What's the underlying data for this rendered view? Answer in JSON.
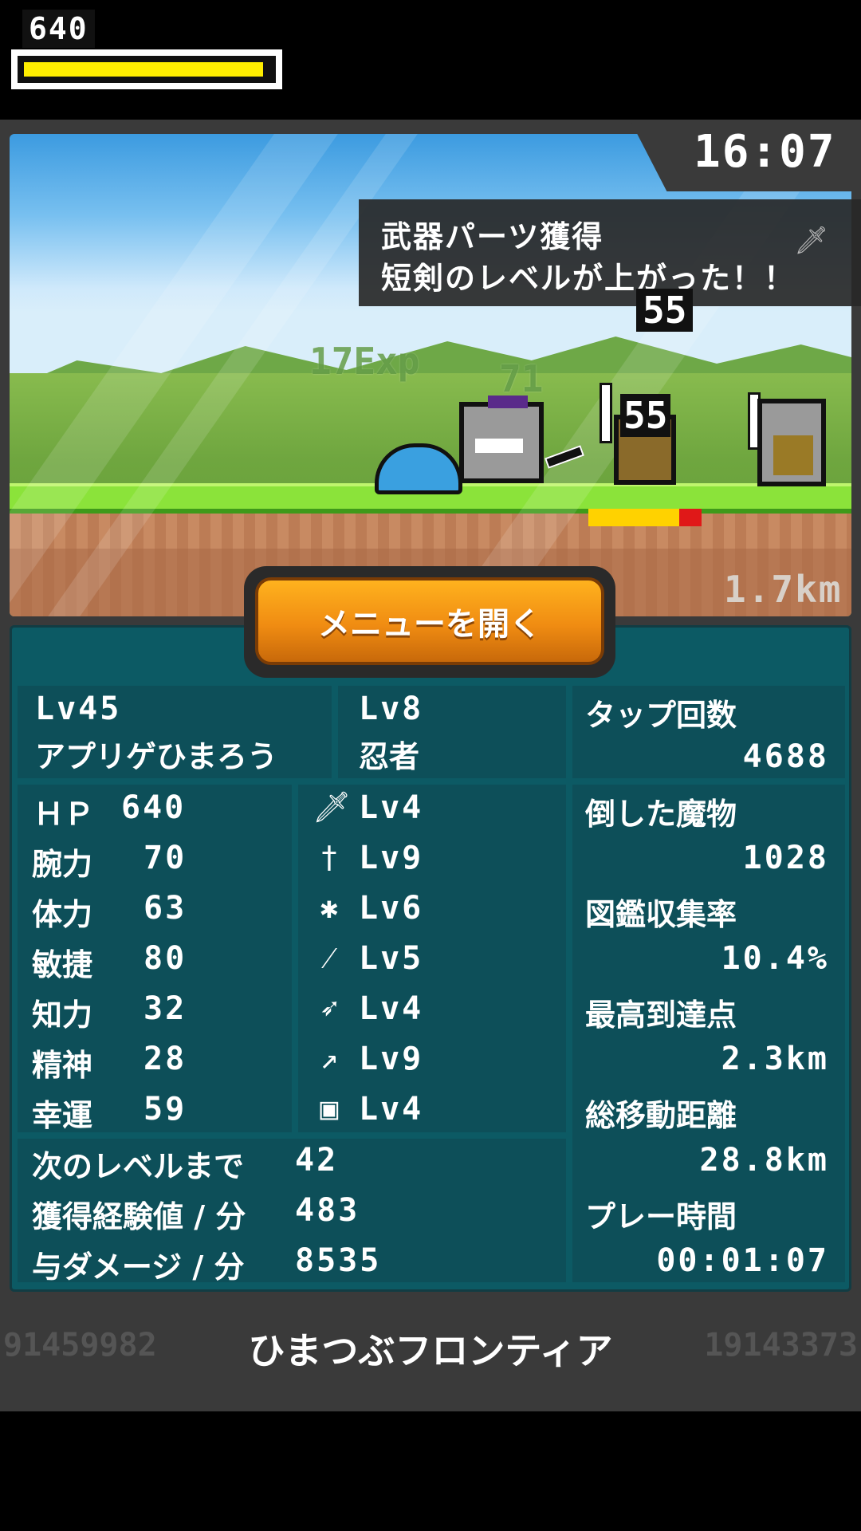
{
  "hud": {
    "hp_value": "640",
    "hp_fill": 0.95,
    "clock": "16:07",
    "distance": "1.7km"
  },
  "toast": {
    "line1": "武器パーツ獲得",
    "line2": "短剣のレベルが上がった！！",
    "icon": "dagger-icon"
  },
  "popups": {
    "damage_top": "55",
    "exp": "17Exp",
    "faded_num": "71",
    "enemy_damage": "55"
  },
  "enemy_hp_fill": 0.8,
  "menu_button": "メニューを開く",
  "player": {
    "level": "Lv45",
    "name": "アプリゲひまろう",
    "class_level": "Lv8",
    "class_name": "忍者"
  },
  "stats": [
    {
      "label": "ＨＰ",
      "value": "640"
    },
    {
      "label": "腕力",
      "value": "70"
    },
    {
      "label": "体力",
      "value": "63"
    },
    {
      "label": "敏捷",
      "value": "80"
    },
    {
      "label": "知力",
      "value": "32"
    },
    {
      "label": "精神",
      "value": "28"
    },
    {
      "label": "幸運",
      "value": "59"
    }
  ],
  "weapons": [
    {
      "icon": "sword-icon",
      "level": "Lv4"
    },
    {
      "icon": "dagger-icon",
      "level": "Lv9"
    },
    {
      "icon": "axe-icon",
      "level": "Lv6"
    },
    {
      "icon": "spear-icon",
      "level": "Lv5"
    },
    {
      "icon": "bow-icon",
      "level": "Lv4"
    },
    {
      "icon": "staff-icon",
      "level": "Lv9"
    },
    {
      "icon": "shield-icon",
      "level": "Lv4"
    }
  ],
  "extra": [
    {
      "label": "次のレベルまで",
      "value": "42"
    },
    {
      "label": "獲得経験値 / 分",
      "value": "483"
    },
    {
      "label": "与ダメージ / 分",
      "value": "8535"
    }
  ],
  "records": [
    {
      "label": "タップ回数",
      "value": "4688"
    },
    {
      "label": "倒した魔物",
      "value": "1028"
    },
    {
      "label": "図鑑収集率",
      "value": "10.4%"
    },
    {
      "label": "最高到達点",
      "value": "2.3km"
    },
    {
      "label": "総移動距離",
      "value": "28.8km"
    },
    {
      "label": "プレー時間",
      "value": "00:01:07"
    }
  ],
  "footer": {
    "title": "ひまつぶフロンティア",
    "left_number": "91459982",
    "right_number": "19143373"
  }
}
